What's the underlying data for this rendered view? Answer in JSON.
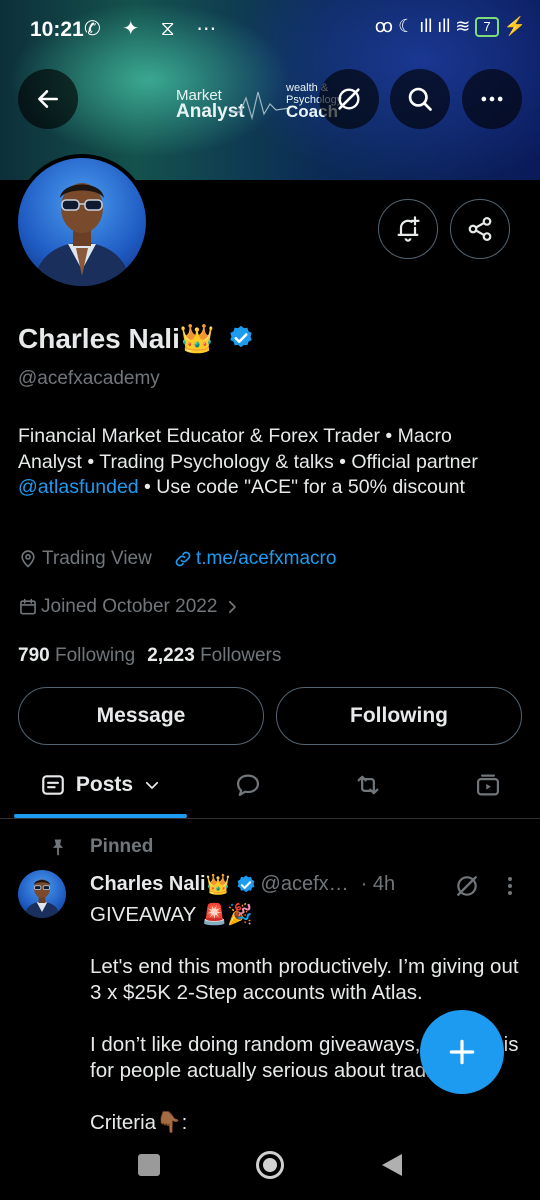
{
  "status_bar": {
    "time": "10:21",
    "left_icons": "✆ ✦ ⧖ ⋯",
    "right_icons": "ꝏ ☾ ıll ıll ≋",
    "battery": "7"
  },
  "banner": {
    "line1_small": "Market",
    "line1_big": "Analyst",
    "line2_small1": "wealth &",
    "line2_small2": "Psychology",
    "line2_big": "Coach"
  },
  "profile": {
    "name": "Charles Nali",
    "name_emoji": "👑",
    "handle": "@acefxacademy",
    "bio_before_link": "Financial Market Educator & Forex Trader • Macro Analyst • Trading Psychology & talks • Official partner ",
    "bio_link": "@atlasfunded",
    "bio_after_link": " • Use code \"ACE\" for a 50% discount",
    "location": "Trading View",
    "website": "t.me/acefxmacro",
    "joined": "Joined October 2022",
    "following_count": "790",
    "following_label": "Following",
    "followers_count": "2,223",
    "followers_label": "Followers"
  },
  "buttons": {
    "message": "Message",
    "following": "Following"
  },
  "tabs": {
    "posts": "Posts"
  },
  "pinned_tweet": {
    "pinned_label": "Pinned",
    "author": "Charles Nali",
    "author_emoji": "👑",
    "handle": "@acefx…",
    "time": "· 4h",
    "lines": [
      "GIVEAWAY 🚨🎉",
      "",
      "Let's end this month productively. I’m giving out 3 x $25K 2-Step accounts with Atlas.",
      "",
      "I don’t like doing random giveaways, this one is for people actually serious about trading.",
      "",
      "Criteria👇🏾:"
    ]
  },
  "colors": {
    "accent": "#1d9bf0",
    "background": "#000000",
    "text": "#e7e9ea",
    "muted": "#71767b"
  }
}
